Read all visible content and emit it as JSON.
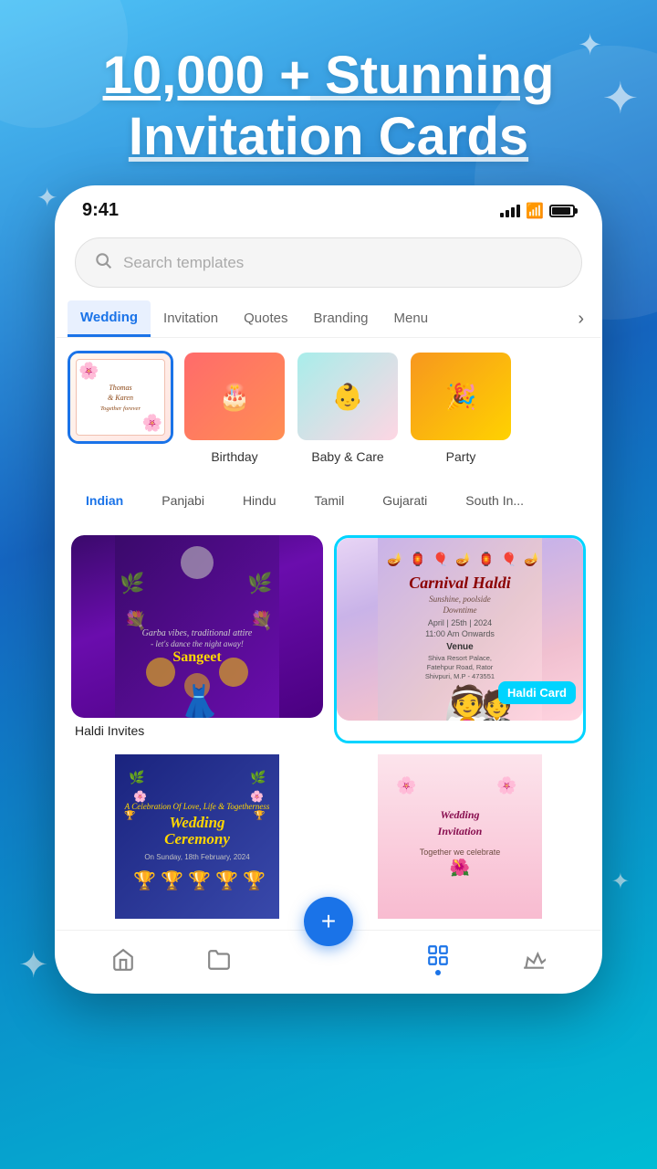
{
  "meta": {
    "background_gradient_start": "#4fc3f7",
    "background_gradient_end": "#1565c0"
  },
  "hero": {
    "title_line1": "10,000 + Stunning",
    "title_line2": "Invitation Cards",
    "title_underline": "10,000 +"
  },
  "status_bar": {
    "time": "9:41",
    "signal": "signal",
    "wifi": "wifi",
    "battery": "battery"
  },
  "search": {
    "placeholder": "Search templates"
  },
  "tabs": [
    {
      "id": "wedding",
      "label": "Wedding",
      "active": true
    },
    {
      "id": "invitation",
      "label": "Invitation",
      "active": false
    },
    {
      "id": "quotes",
      "label": "Quotes",
      "active": false
    },
    {
      "id": "branding",
      "label": "Branding",
      "active": false
    },
    {
      "id": "menu",
      "label": "Menu",
      "active": false
    }
  ],
  "categories": [
    {
      "id": "wedding-selected",
      "label": "",
      "selected": true
    },
    {
      "id": "birthday",
      "label": "Birthday",
      "selected": false
    },
    {
      "id": "baby-care",
      "label": "Baby & Care",
      "selected": false
    },
    {
      "id": "party",
      "label": "Party",
      "selected": false
    }
  ],
  "filters": [
    {
      "id": "indian",
      "label": "Indian",
      "active": true
    },
    {
      "id": "panjabi",
      "label": "Panjabi",
      "active": false
    },
    {
      "id": "hindu",
      "label": "Hindu",
      "active": false
    },
    {
      "id": "tamil",
      "label": "Tamil",
      "active": false
    },
    {
      "id": "gujarati",
      "label": "Gujarati",
      "active": false
    },
    {
      "id": "south-indian",
      "label": "South In...",
      "active": false
    }
  ],
  "cards": [
    {
      "id": "sangeet",
      "label": "Haldi Invites",
      "badge": null,
      "type": "sangeet"
    },
    {
      "id": "haldi",
      "label": "Haldi Card",
      "badge": "Haldi Card",
      "type": "haldi",
      "selected": true,
      "event_name": "Carnival Haldi",
      "event_subtitle": "Sunshine, poolside Downtime",
      "event_date": "April | 25th | 2024",
      "event_time": "11:00 Am Onwards",
      "venue_label": "Venue",
      "venue_address": "Shiva Resort Palace, Fatehpur Road, Rator, Shivpuri, Madhya Pradesh - 473551"
    }
  ],
  "bottom_row_cards": [
    {
      "id": "wedding-ceremony",
      "label": "",
      "type": "ceremony"
    },
    {
      "id": "partial-card",
      "label": "",
      "type": "partial"
    }
  ],
  "bottom_nav": [
    {
      "id": "home",
      "label": "Home",
      "icon": "🏠",
      "active": false
    },
    {
      "id": "folder",
      "label": "Folder",
      "icon": "📁",
      "active": false
    },
    {
      "id": "grid",
      "label": "Grid",
      "icon": "⊞",
      "active": true
    },
    {
      "id": "crown",
      "label": "Crown",
      "icon": "♛",
      "active": false
    }
  ],
  "fab": {
    "label": "+"
  }
}
